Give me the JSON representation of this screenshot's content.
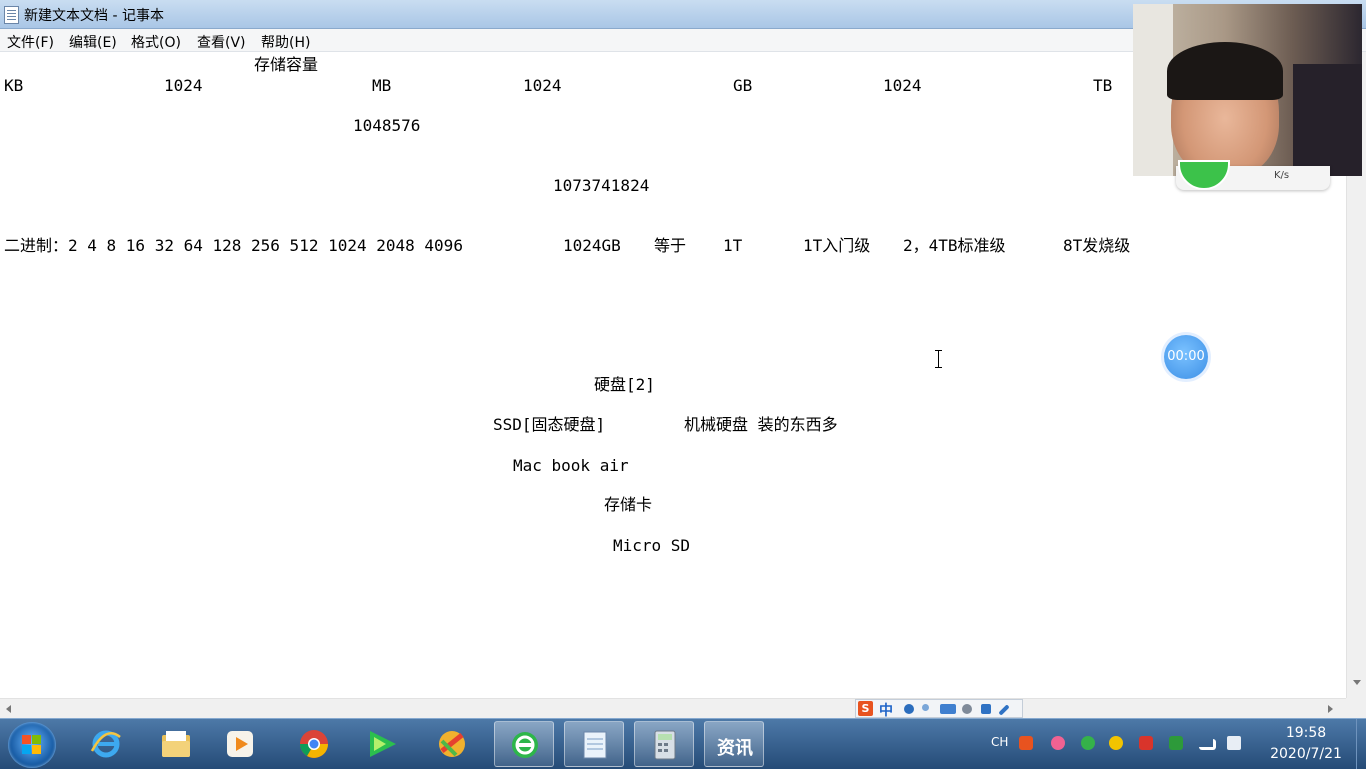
{
  "window": {
    "title": "新建文本文档 - 记事本"
  },
  "menu": [
    "文件(F)",
    "编辑(E)",
    "格式(O)",
    "查看(V)",
    "帮助(H)"
  ],
  "document": {
    "lines": [
      "存储容量",
      "KB",
      "1024",
      "MB",
      "1024",
      "GB",
      "1024",
      "TB",
      "1048576",
      "1073741824",
      "二进制：2 4 8 16 32 64 128 256 512 1024 2048 4096",
      "1024GB",
      "等于",
      "1T",
      "1T入门级",
      "2，4TB标准级",
      "8T发烧级",
      "硬盘[2]",
      "SSD[固态硬盘]",
      "机械硬盘 装的东西多",
      "Mac book air",
      "存储卡",
      "Micro SD"
    ]
  },
  "recorder": {
    "timer": "00:00",
    "rate": "K/s"
  },
  "ime": {
    "mode": "中"
  },
  "taskbar": {
    "apps": [
      "start-orb",
      "internet-explorer",
      "file-explorer",
      "media-player",
      "chrome",
      "video-player",
      "color-app",
      "browser-360",
      "notepad",
      "calculator",
      "news"
    ],
    "news_label": "资讯"
  },
  "tray": {
    "language": "CH",
    "time": "19:58",
    "date": "2020/7/21"
  },
  "colors": {
    "taskbar": "#254b77",
    "titlebar": "#c9ddf1",
    "timer": "#3c8fe6",
    "recorder_green": "#3cc24a"
  }
}
